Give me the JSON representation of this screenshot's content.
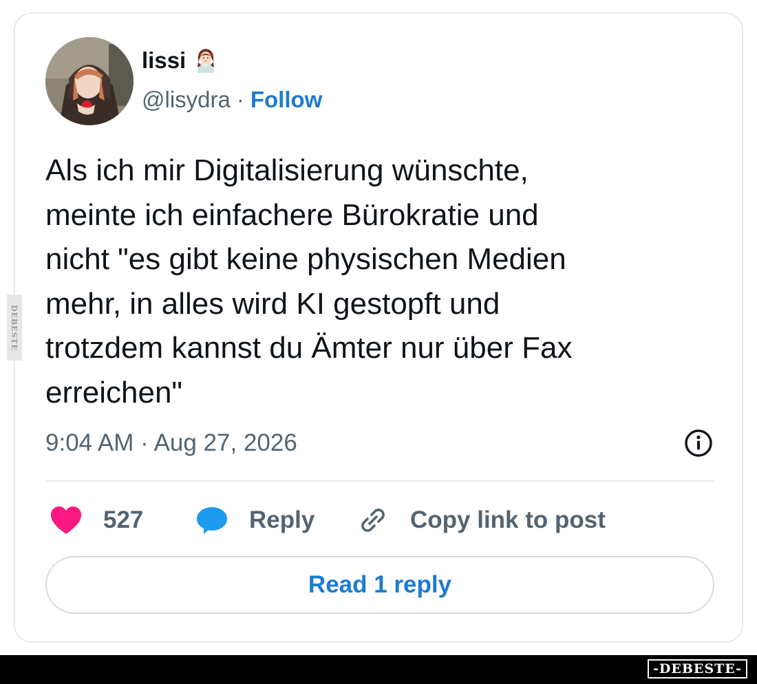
{
  "tweet": {
    "author": {
      "display_name": "lissi",
      "name_emoji": "woman-emoji",
      "handle": "@lisydra",
      "separator": "·",
      "follow_label": "Follow"
    },
    "text": "Als ich mir Digitalisierung wünschte,\nmeinte ich einfachere Bürokratie und\nnicht \"es gibt keine physischen Medien\nmehr, in alles wird KI gestopft und\ntrotzdem kannst du Ämter nur über Fax\nerreichen\"",
    "timestamp": "9:04 AM · Aug 27, 2026",
    "actions": {
      "like_count": "527",
      "reply_label": "Reply",
      "copy_label": "Copy link to post"
    },
    "read_replies_label": "Read 1 reply"
  },
  "watermark": {
    "side_text": "DEBESTE",
    "logo_text": "-DEBESTE-"
  },
  "colors": {
    "accent": "#1d7bd0",
    "heart": "#f91880",
    "reply_bubble": "#1d9bf0",
    "muted": "#536471"
  }
}
